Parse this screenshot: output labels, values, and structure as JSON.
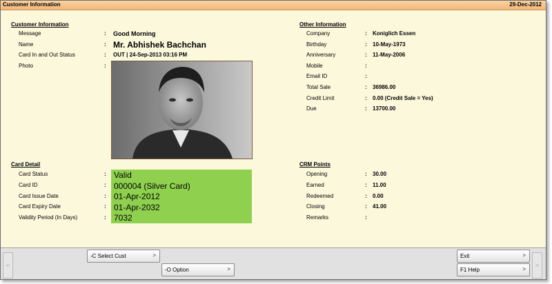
{
  "window": {
    "title": "Customer Information",
    "date": "29-Dec-2012"
  },
  "customer_info": {
    "heading": "Customer Information",
    "rows": [
      {
        "label": "Message",
        "value": "Good Morning"
      },
      {
        "label": "Name",
        "value": "Mr. Abhishek Bachchan"
      },
      {
        "label": "Card In and Out Status",
        "value": "OUT | 24-Sep-2013 03:16 PM"
      },
      {
        "label": "Photo",
        "value": ""
      }
    ]
  },
  "other_info": {
    "heading": "Other Information",
    "rows": [
      {
        "label": "Company",
        "value": "Koniglich Essen"
      },
      {
        "label": "Birthday",
        "value": "10-May-1973"
      },
      {
        "label": "Anniversary",
        "value": "11-May-2006"
      },
      {
        "label": "Mobile",
        "value": ""
      },
      {
        "label": "Email ID",
        "value": ""
      },
      {
        "label": "Total Sale",
        "value": "36986.00"
      },
      {
        "label": "Credit Limit",
        "value": "0.00 (Credit Sale = Yes)"
      },
      {
        "label": "Due",
        "value": "13700.00"
      }
    ]
  },
  "card_detail": {
    "heading": "Card Detail",
    "rows": [
      {
        "label": "Card Status",
        "value": "Valid"
      },
      {
        "label": "Card ID",
        "value": "000004 (Silver Card)"
      },
      {
        "label": "Card Issue Date",
        "value": "01-Apr-2012"
      },
      {
        "label": "Card Expiry Date",
        "value": "01-Apr-2032"
      },
      {
        "label": "Validity Period (In Days)",
        "value": "7032"
      }
    ],
    "highlight_color": "#8fd14f"
  },
  "crm_points": {
    "heading": "CRM Points",
    "rows": [
      {
        "label": "Opening",
        "value": "30.00"
      },
      {
        "label": "Earned",
        "value": "11.00"
      },
      {
        "label": "Redeemed",
        "value": "0.00"
      },
      {
        "label": "Closing",
        "value": "41.00"
      },
      {
        "label": "Remarks",
        "value": ""
      }
    ]
  },
  "buttons": {
    "select_cust": "-C Select Cust",
    "option": "-O Option",
    "exit": "Exit",
    "help": "F1 Help",
    "arrow": ">"
  },
  "icons": {
    "left_scroll": "<",
    "right_scroll": ">"
  }
}
